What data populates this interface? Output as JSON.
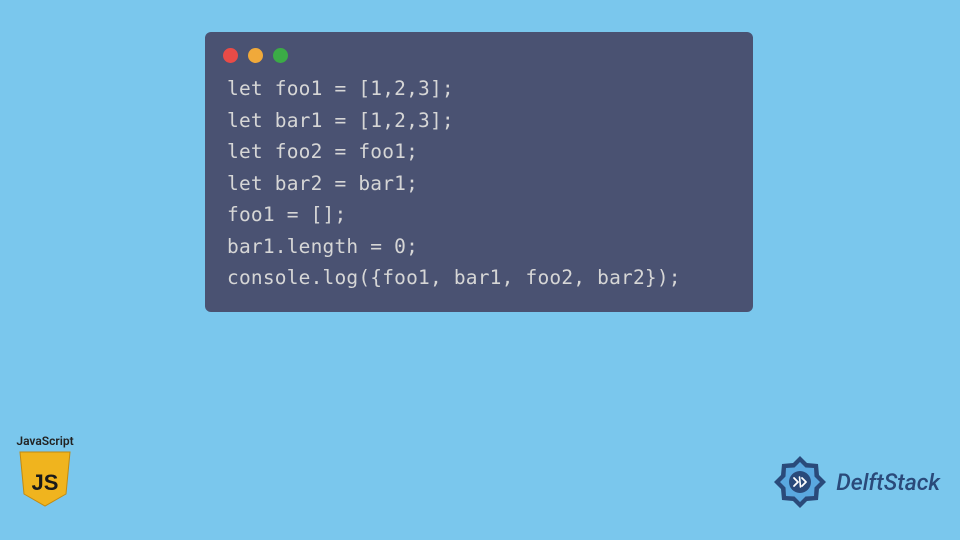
{
  "code": {
    "lines": [
      "let foo1 = [1,2,3];",
      "let bar1 = [1,2,3];",
      "let foo2 = foo1;",
      "let bar2 = bar1;",
      "foo1 = [];",
      "bar1.length = 0;",
      "console.log({foo1, bar1, foo2, bar2});"
    ]
  },
  "badge": {
    "label": "JavaScript",
    "js_text": "JS"
  },
  "brand": {
    "name": "DelftStack"
  },
  "colors": {
    "bg": "#7ac7ed",
    "window": "#4a5272",
    "red": "#e94b47",
    "yellow": "#f0a93a",
    "green": "#3bab46",
    "js_yellow": "#f0b41e",
    "brand_blue": "#2a4a7a"
  }
}
